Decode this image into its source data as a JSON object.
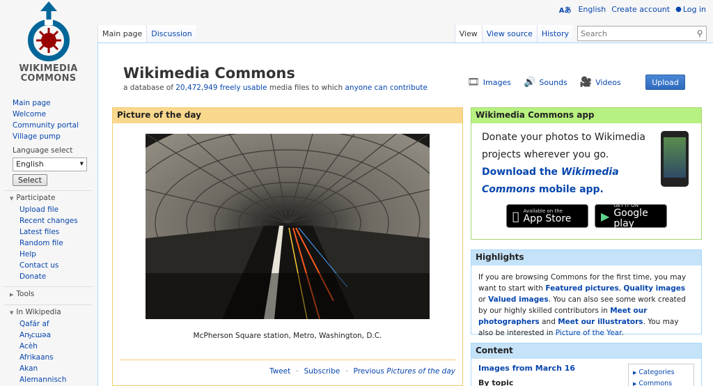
{
  "personal": {
    "language": "English",
    "create_account": "Create account",
    "login": "Log in",
    "lang_icon": "Aあ"
  },
  "logo": {
    "line1": "WIKIMEDIA",
    "line2": "COMMONS"
  },
  "sidebar": {
    "nav": [
      "Main page",
      "Welcome",
      "Community portal",
      "Village pump"
    ],
    "language_label": "Language select",
    "language_value": "English",
    "select_label": "Select",
    "participate": {
      "label": "Participate",
      "items": [
        "Upload file",
        "Recent changes",
        "Latest files",
        "Random file",
        "Help",
        "Contact us",
        "Donate"
      ]
    },
    "tools_label": "Tools",
    "in_wikipedia": {
      "label": "In Wikipedia",
      "items": [
        "Qafár af",
        "Аҧсшәа",
        "Acèh",
        "Afrikaans",
        "Akan",
        "Alemannisch"
      ]
    }
  },
  "tabs": {
    "left": [
      "Main page",
      "Discussion"
    ],
    "right": [
      "View",
      "View source",
      "History"
    ]
  },
  "search": {
    "placeholder": "Search"
  },
  "page": {
    "title": "Wikimedia Commons",
    "subtitle_pre": "a database of ",
    "file_count": "20,472,949",
    "freely_usable": "freely usable",
    "subtitle_mid": " media files to which ",
    "anyone_contribute": "anyone can contribute"
  },
  "media_links": [
    "Images",
    "Sounds",
    "Videos"
  ],
  "upload_label": "Upload",
  "potd": {
    "header": "Picture of the day",
    "caption": "McPherson Square station, Metro, Washington, D.C.",
    "tweet": "Tweet",
    "subscribe": "Subscribe",
    "previous_prefix": "Previous ",
    "previous_em": "Pictures of the day"
  },
  "app": {
    "header": "Wikimedia Commons app",
    "text": "Donate your photos to Wikimedia projects wherever you go.",
    "download_pre": "Download the ",
    "download_em": "Wikimedia Commons",
    "download_post": " mobile app.",
    "appstore_small": "Available on the",
    "appstore_big": "App Store",
    "gplay_small": "GET IT ON",
    "gplay_big": "Google play"
  },
  "highlights": {
    "header": "Highlights",
    "t1": "If you are browsing Commons for the first time, you may want to start with ",
    "featured": "Featured pictures",
    "sep1": ", ",
    "quality": "Quality images",
    "or": " or ",
    "valued": "Valued images",
    "t2": ". You can also see some work created by our highly skilled contributors in ",
    "photographers": "Meet our photographers",
    "and": " and ",
    "illustrators": "Meet our illustrators",
    "t3": ". You may also be interested in ",
    "poty": "Picture of the Year",
    "end": "."
  },
  "contentbox": {
    "header": "Content",
    "images_from": "Images from March 16",
    "by_topic": "By topic",
    "side": [
      "Categories",
      "Commons"
    ]
  }
}
